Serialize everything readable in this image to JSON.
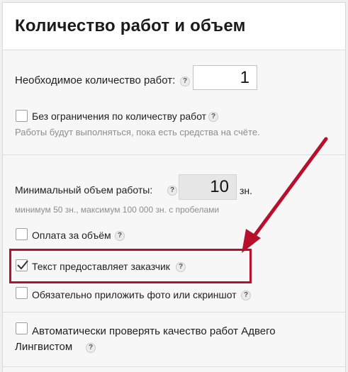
{
  "section_title": "Количество работ и объем",
  "work_count": {
    "label": "Необходимое количество работ:",
    "value": "1"
  },
  "unlimited": {
    "label": "Без ограничения по количеству работ",
    "hint": "Работы будут выполняться, пока есть средства на счёте.",
    "checked": false
  },
  "min_volume": {
    "label": "Минимальный объем работы:",
    "value": "10",
    "unit": "зн.",
    "hint": "минимум 50 зн., максимум 100 000 зн. с пробелами"
  },
  "options": [
    {
      "label": "Оплата за объём",
      "checked": false
    },
    {
      "label": "Текст предоставляет заказчик",
      "checked": true
    },
    {
      "label": "Обязательно приложить фото или скриншот",
      "checked": false
    }
  ],
  "auto_check": {
    "label_line1": "Автоматически проверять качество работ Адвего",
    "label_line2": "Лингвистом",
    "checked": false
  },
  "help_glyph": "?",
  "colors": {
    "highlight": "#b8102b",
    "arrow": "#b8102b"
  }
}
